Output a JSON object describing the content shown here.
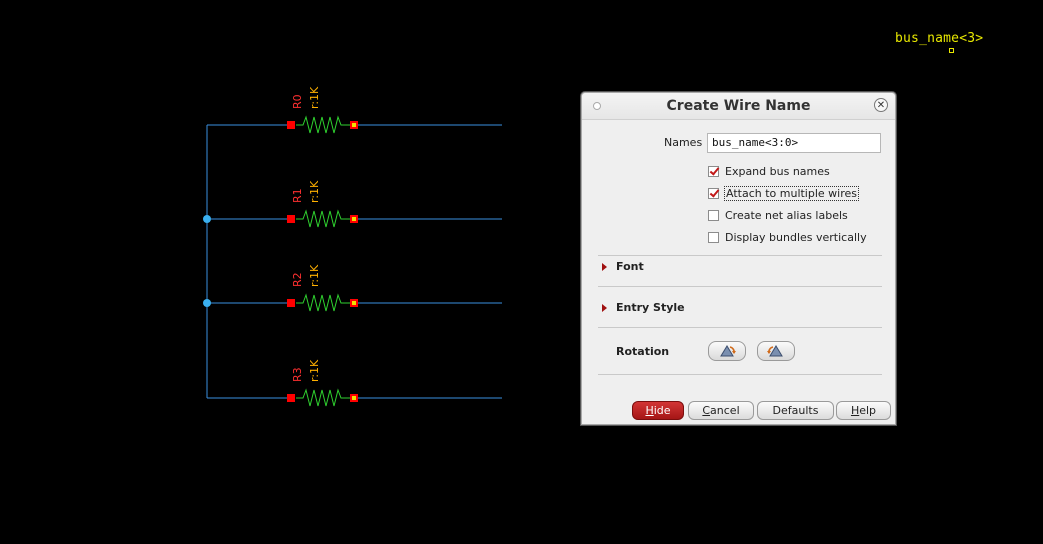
{
  "canvas": {
    "cursor_label": "bus_name<3>",
    "resistors": [
      {
        "name": "R0",
        "value": "r:1K"
      },
      {
        "name": "R1",
        "value": "r:1K"
      },
      {
        "name": "R2",
        "value": "r:1K"
      },
      {
        "name": "R3",
        "value": "r:1K"
      }
    ],
    "colors": {
      "wire": "#3a8fe0",
      "resistor": "#2fd12f",
      "pin": "#ff0000",
      "label": "#ff3030",
      "value_label": "#ffb000",
      "cursor_text": "#e8e800"
    }
  },
  "dialog": {
    "title": "Create Wire Name",
    "names_label": "Names",
    "names_value": "bus_name<3:0>",
    "checkboxes": [
      {
        "label": "Expand bus names",
        "checked": true
      },
      {
        "label": "Attach to multiple wires",
        "checked": true
      },
      {
        "label": "Create net alias labels",
        "checked": false
      },
      {
        "label": "Display bundles vertically",
        "checked": false
      }
    ],
    "sections": {
      "font": "Font",
      "entry_style": "Entry Style"
    },
    "rotation_label": "Rotation",
    "buttons": {
      "hide_first": "H",
      "hide_rest": "ide",
      "cancel_first": "C",
      "cancel_rest": "ancel",
      "defaults": "Defaults",
      "help_first": "H",
      "help_rest": "elp"
    },
    "accent": "#b51c1c"
  }
}
